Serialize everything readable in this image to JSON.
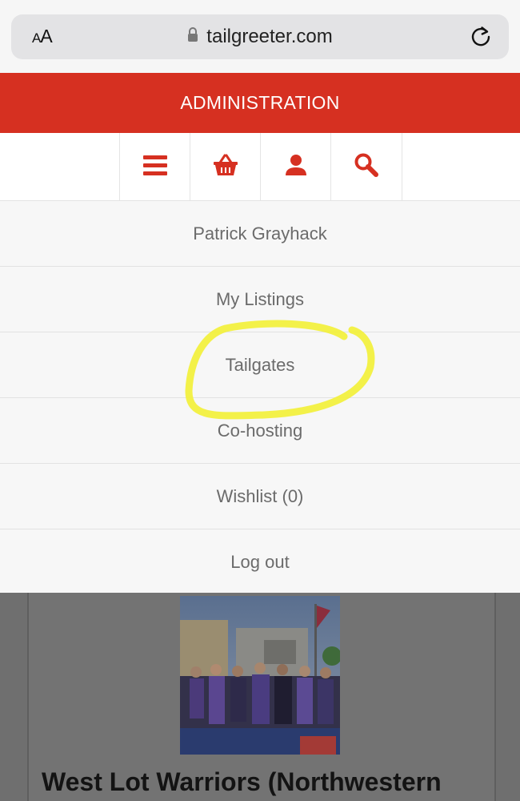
{
  "browser": {
    "text_size_button": "AA",
    "url": "tailgreeter.com"
  },
  "header": {
    "title": "ADMINISTRATION",
    "accent_color": "#d63021"
  },
  "toolbar": {
    "icons": [
      "menu-icon",
      "basket-icon",
      "user-icon",
      "search-icon"
    ]
  },
  "menu": {
    "items": [
      {
        "label": "Patrick Grayhack"
      },
      {
        "label": "My Listings"
      },
      {
        "label": "Tailgates"
      },
      {
        "label": "Co-hosting"
      },
      {
        "label": "Wishlist (0)"
      },
      {
        "label": "Log out"
      }
    ]
  },
  "listing": {
    "title": "West Lot Warriors (Northwestern"
  },
  "annotation": {
    "color": "#f2f03a",
    "target": "Tailgates"
  }
}
